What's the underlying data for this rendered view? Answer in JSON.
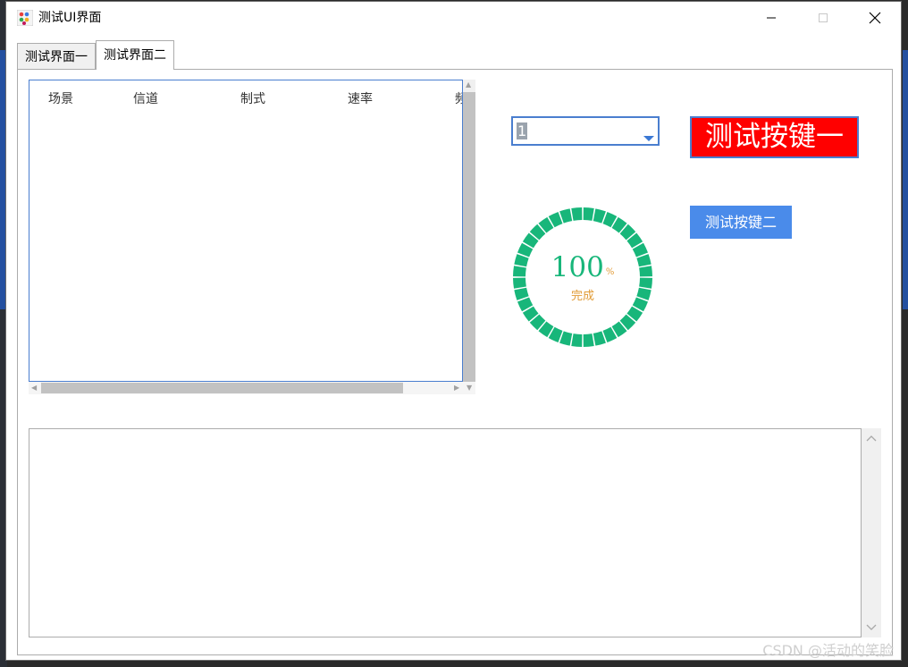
{
  "window": {
    "title": "测试UI界面"
  },
  "tabs": [
    {
      "label": "测试界面一"
    },
    {
      "label": "测试界面二"
    }
  ],
  "list": {
    "columns": [
      "场景",
      "信道",
      "制式",
      "速率",
      "频"
    ]
  },
  "combo": {
    "value": "1"
  },
  "buttons": {
    "test1": "测试按键一",
    "test2": "测试按键二"
  },
  "progress": {
    "value": "100",
    "unit": "%",
    "label": "完成",
    "percent": 100,
    "ring_color": "#18b67a",
    "text_color": "#e19b36"
  },
  "watermark": "CSDN @活动的笑脸",
  "colors": {
    "accent": "#4a7ecf",
    "button1_bg": "#ff0000",
    "button2_bg": "#4a8bea"
  },
  "icons": {
    "app": "app-colored-dots-icon",
    "minimize": "minimize-icon",
    "maximize": "maximize-icon",
    "close": "close-icon"
  }
}
